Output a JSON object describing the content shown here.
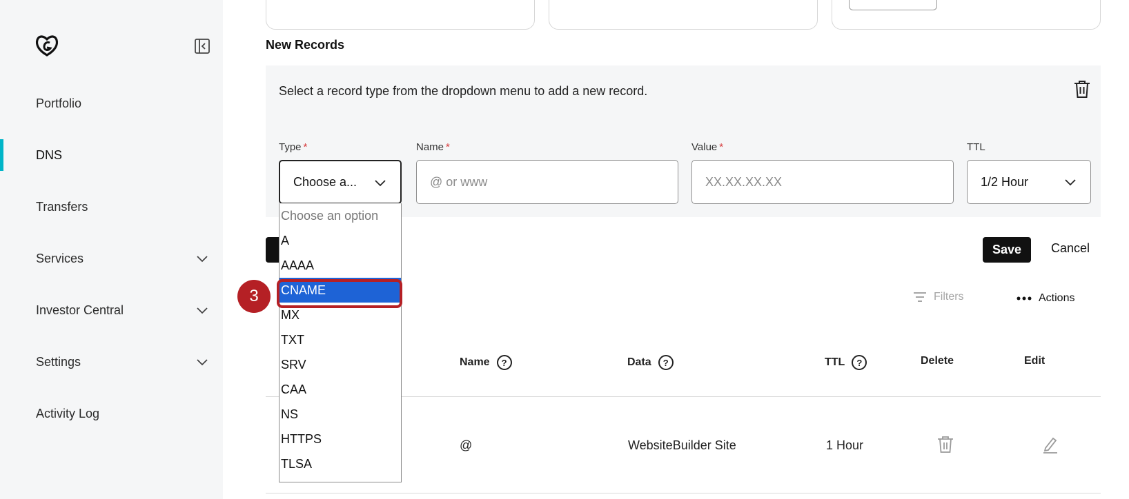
{
  "sidebar": {
    "items": [
      {
        "label": "Portfolio",
        "has_chevron": false
      },
      {
        "label": "DNS",
        "has_chevron": false,
        "active": true
      },
      {
        "label": "Transfers",
        "has_chevron": false
      },
      {
        "label": "Services",
        "has_chevron": true
      },
      {
        "label": "Investor Central",
        "has_chevron": true
      },
      {
        "label": "Settings",
        "has_chevron": true
      },
      {
        "label": "Activity Log",
        "has_chevron": false
      }
    ]
  },
  "new_records": {
    "title": "New Records",
    "message": "Select a record type from the dropdown menu to add a new record.",
    "fields": {
      "type": {
        "label": "Type",
        "value": "Choose a..."
      },
      "name": {
        "label": "Name",
        "placeholder": "@ or www"
      },
      "value": {
        "label": "Value",
        "placeholder": "XX.XX.XX.XX"
      },
      "ttl": {
        "label": "TTL",
        "value": "1/2 Hour"
      }
    },
    "required_mark": "*",
    "type_options": [
      "Choose an option",
      "A",
      "AAAA",
      "CNAME",
      "MX",
      "TXT",
      "SRV",
      "CAA",
      "NS",
      "HTTPS",
      "TLSA"
    ],
    "selected_option": "CNAME",
    "save_label": "Save",
    "cancel_label": "Cancel"
  },
  "step_badge": "3",
  "toolbar": {
    "filters_label": "Filters",
    "actions_label": "Actions"
  },
  "table": {
    "headers": {
      "name": "Name",
      "data": "Data",
      "ttl": "TTL",
      "delete": "Delete",
      "edit": "Edit"
    },
    "rows": [
      {
        "name": "@",
        "data": "WebsiteBuilder Site",
        "ttl": "1 Hour"
      }
    ]
  },
  "colors": {
    "accent": "#00b5c8",
    "annotation": "#b52025",
    "selection": "#1e63d6"
  }
}
